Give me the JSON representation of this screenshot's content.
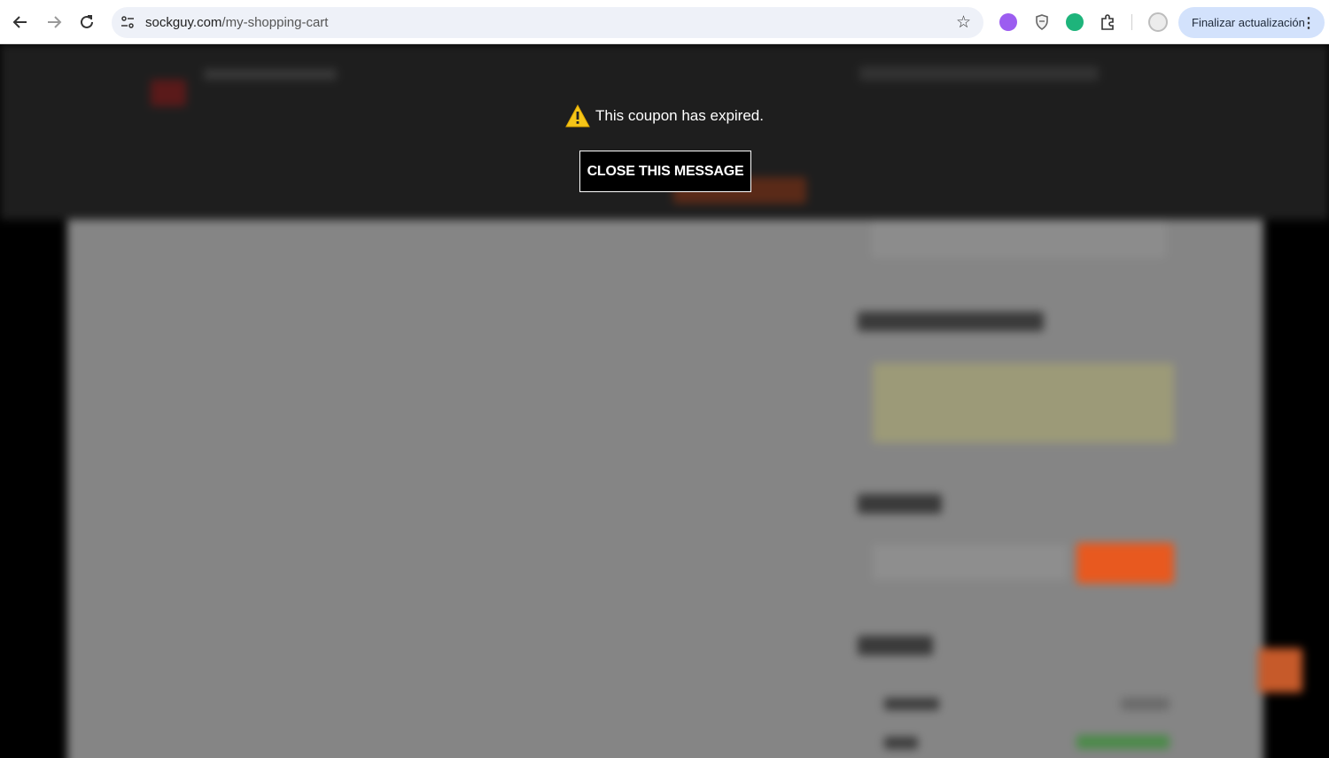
{
  "browser": {
    "url_host": "sockguy.com",
    "url_path": "/my-shopping-cart",
    "update_button_label": "Finalizar actualización",
    "back_icon": "arrow-left-icon",
    "forward_icon": "arrow-right-icon",
    "reload_icon": "reload-icon",
    "star_icon": "star-icon",
    "menu_icon": "kebab-menu-icon"
  },
  "overlay": {
    "message": "This coupon has expired.",
    "close_label": "CLOSE THIS MESSAGE",
    "warning_icon": "warning-icon",
    "warning_color": "#f5c518"
  },
  "colors": {
    "accent_orange": "#e8591f",
    "overlay_dark": "#1e1e1e",
    "page_gray": "#858585"
  }
}
